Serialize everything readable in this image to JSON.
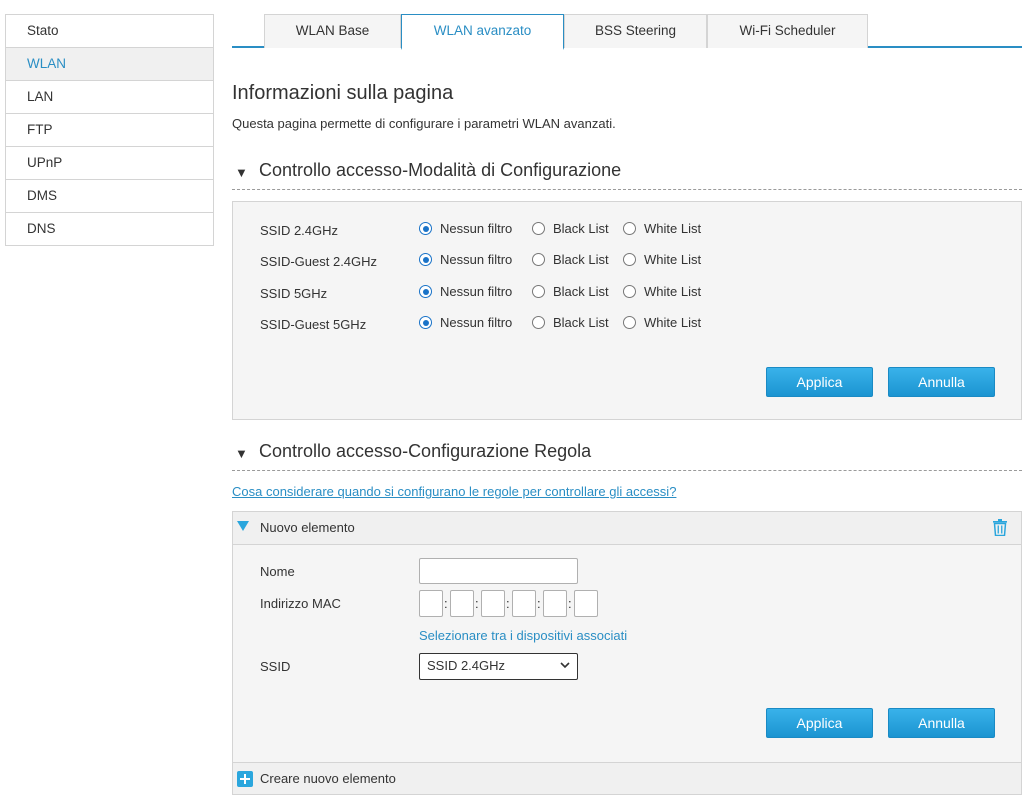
{
  "sidebar": {
    "items": [
      {
        "label": "Stato",
        "active": false
      },
      {
        "label": "WLAN",
        "active": true
      },
      {
        "label": "LAN",
        "active": false
      },
      {
        "label": "FTP",
        "active": false
      },
      {
        "label": "UPnP",
        "active": false
      },
      {
        "label": "DMS",
        "active": false
      },
      {
        "label": "DNS",
        "active": false
      }
    ]
  },
  "tabs": [
    {
      "label": "WLAN Base",
      "active": false
    },
    {
      "label": "WLAN avanzato",
      "active": true
    },
    {
      "label": "BSS Steering",
      "active": false
    },
    {
      "label": "Wi-Fi Scheduler",
      "active": false
    }
  ],
  "page": {
    "title": "Informazioni sulla pagina",
    "description": "Questa pagina permette di configurare i parametri WLAN avanzati."
  },
  "access_mode": {
    "section_title": "Controllo accesso-Modalità di Configurazione",
    "options": [
      "Nessun filtro",
      "Black List",
      "White List"
    ],
    "rows": [
      {
        "ssid": "SSID 2.4GHz",
        "selected": "Nessun filtro"
      },
      {
        "ssid": "SSID-Guest 2.4GHz",
        "selected": "Nessun filtro"
      },
      {
        "ssid": "SSID 5GHz",
        "selected": "Nessun filtro"
      },
      {
        "ssid": "SSID-Guest 5GHz",
        "selected": "Nessun filtro"
      }
    ],
    "apply_label": "Applica",
    "cancel_label": "Annulla"
  },
  "rule_config": {
    "section_title": "Controllo accesso-Configurazione Regola",
    "help_link": "Cosa considerare quando si configurano le regole per controllare gli accessi?",
    "item_title": "Nuovo elemento",
    "name_label": "Nome",
    "name_value": "",
    "mac_label": "Indirizzo MAC",
    "mac_values": [
      "",
      "",
      "",
      "",
      "",
      ""
    ],
    "mac_separator": ":",
    "select_devices_link": "Selezionare tra i dispositivi associati",
    "ssid_label": "SSID",
    "ssid_selected": "SSID 2.4GHz",
    "apply_label": "Applica",
    "cancel_label": "Annulla",
    "create_label": "Creare nuovo elemento"
  },
  "colors": {
    "accent": "#2a8ec4",
    "button": "#1b94d1",
    "icon": "#2aa6dd"
  }
}
